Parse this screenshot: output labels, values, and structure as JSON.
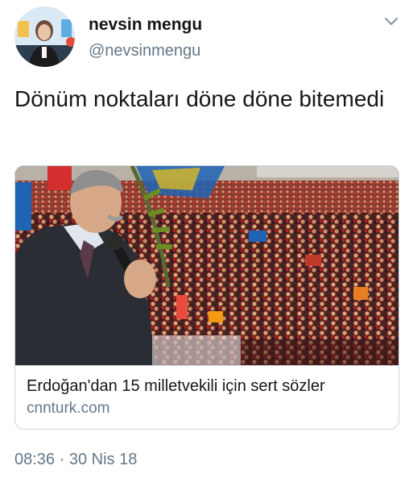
{
  "author": {
    "display_name": "nevsin mengu",
    "handle": "@nevsinmengu",
    "avatar_icon": "profile-photo"
  },
  "menu_icon": "chevron-down-icon",
  "tweet": {
    "text": "Dönüm noktaları döne döne bitemedi"
  },
  "card": {
    "title": "Erdoğan'dan 15 milletvekili için sert sözler",
    "domain": "cnnturk.com",
    "image_icon": "rally-photo"
  },
  "timestamp": "08:36 · 30 Nis 18",
  "colors": {
    "text_primary": "#14171a",
    "text_secondary": "#657786",
    "border": "#ccd6dd"
  }
}
